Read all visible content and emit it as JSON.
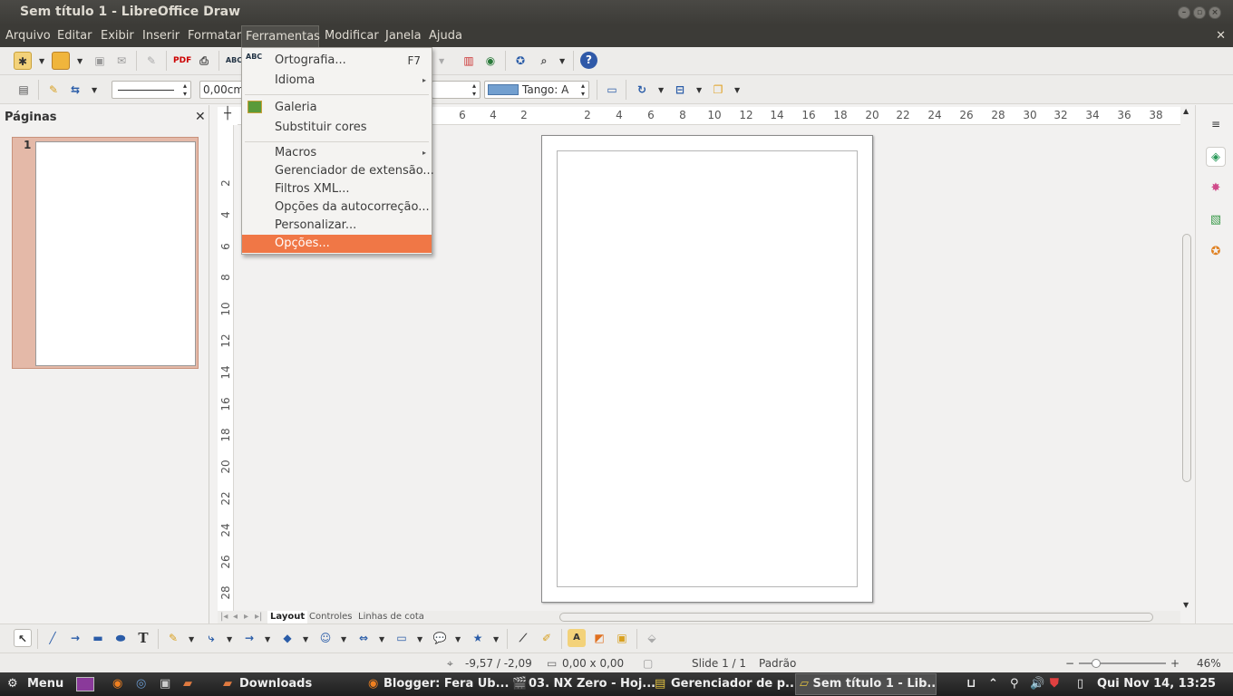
{
  "window": {
    "title": "Sem título 1 - LibreOffice Draw"
  },
  "menubar": {
    "items": [
      "Arquivo",
      "Editar",
      "Exibir",
      "Inserir",
      "Formatar",
      "Ferramentas",
      "Modificar",
      "Janela",
      "Ajuda"
    ],
    "active": "Ferramentas"
  },
  "line_toolbar": {
    "width_value": "0,00cm",
    "area_color": "Tango: A",
    "area_color_hex": "#729fcf"
  },
  "tools_menu": {
    "items": [
      {
        "label": "Ortografia...",
        "shortcut": "F7"
      },
      {
        "label": "Idioma"
      },
      {
        "label": "Galeria"
      },
      {
        "label": "Substituir cores"
      },
      {
        "label": "Macros"
      },
      {
        "label": "Gerenciador de extensão..."
      },
      {
        "label": "Filtros XML..."
      },
      {
        "label": "Opções da autocorreção..."
      },
      {
        "label": "Personalizar..."
      },
      {
        "label": "Opções...",
        "highlighted": true
      }
    ],
    "highlight_color": "#f07746"
  },
  "pages_panel": {
    "title": "Páginas",
    "page_number": "1"
  },
  "ruler": {
    "h_ticks": [
      "6",
      "4",
      "2",
      "2",
      "4",
      "6",
      "8",
      "10",
      "12",
      "14",
      "16",
      "18",
      "20",
      "22",
      "24",
      "26",
      "28",
      "30",
      "32",
      "34",
      "36",
      "38"
    ],
    "v_ticks": [
      "2",
      "4",
      "6",
      "8",
      "10",
      "12",
      "14",
      "16",
      "18",
      "20",
      "22",
      "24",
      "26",
      "28"
    ]
  },
  "layer_tabs": [
    "Layout",
    "Controles",
    "Linhas de cota"
  ],
  "statusbar": {
    "position": "-9,57 / -2,09",
    "size": "0,00 x 0,00",
    "slide": "Slide 1 / 1",
    "master": "Padrão",
    "zoom": "46%"
  },
  "taskbar": {
    "menu": "Menu",
    "items": [
      "Downloads",
      "Blogger: Fera Ub...",
      "03. NX Zero - Hoj...",
      "Gerenciador de p...",
      "Sem título 1 - Lib..."
    ],
    "clock": "Qui Nov 14, 13:25"
  }
}
